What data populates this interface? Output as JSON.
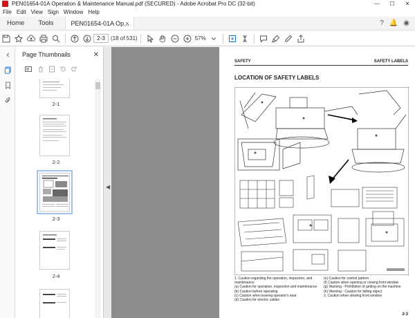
{
  "window": {
    "title": "PEN01654-01A Operation & Maintenance Manual.pdf (SECURED) - Adobe Acrobat Pro DC (32-bit)",
    "controls": [
      "—",
      "☐",
      "✕"
    ]
  },
  "menu": [
    "File",
    "Edit",
    "View",
    "Sign",
    "Window",
    "Help"
  ],
  "tabs": {
    "home": "Home",
    "tools": "Tools",
    "document": "PEN01654-01A Op...",
    "close": "×"
  },
  "toolbar": {
    "page_input": "2-3",
    "page_count": "(18 of 531)",
    "zoom": "57%"
  },
  "thumbnails_panel": {
    "title": "Page Thumbnails",
    "close": "✕",
    "pages": [
      {
        "label": "2-1",
        "selected": false
      },
      {
        "label": "2-2",
        "selected": false
      },
      {
        "label": "2-3",
        "selected": true
      },
      {
        "label": "2-4",
        "selected": false
      }
    ]
  },
  "page": {
    "header_left": "SAFETY",
    "header_right": "SAFETY LABELS",
    "heading": "LOCATION OF SAFETY LABELS",
    "page_number": "2-3",
    "captions_left": [
      "1. Caution regarding the operation, inspection, and maintenance",
      "(a) Caution for operation, inspection and maintenance",
      "(b) Caution before operating",
      "(c) Caution when leaving operator's seat",
      "(d) Caution for electric cables"
    ],
    "captions_right": [
      "(e) Caution for control pattern",
      "(f) Caution when opening or closing front window",
      "(g) Warning - Prohibition of getting on the machine",
      "(h) Warning - Caution for falling object",
      "2. Caution when stowing front window"
    ]
  }
}
